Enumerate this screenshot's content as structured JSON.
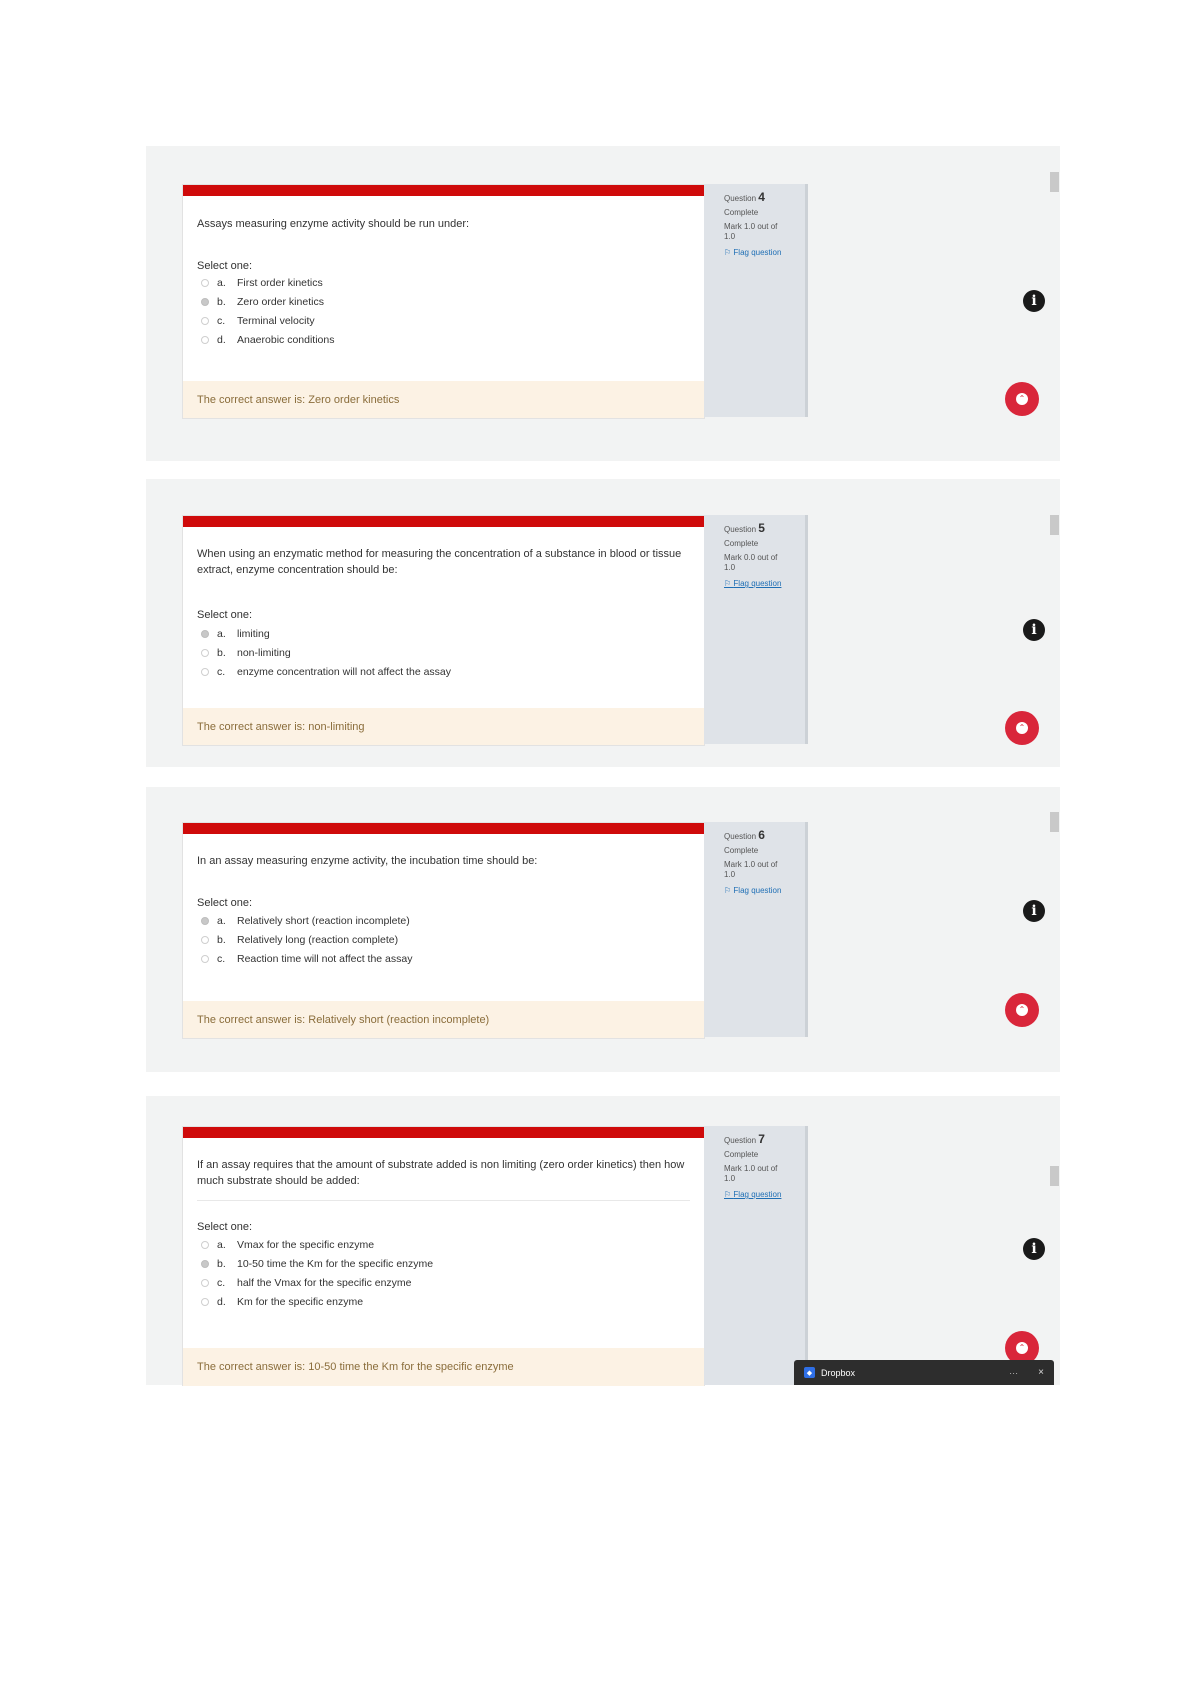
{
  "questions": [
    {
      "number": "4",
      "label": "Question",
      "state": "Complete",
      "mark": "Mark 1.0 out of",
      "mark_total": "1.0",
      "flag": "Flag question",
      "text": "Assays measuring enzyme activity should be run under:",
      "select_label": "Select one:",
      "options": [
        {
          "letter": "a.",
          "text": "First order kinetics",
          "checked": false
        },
        {
          "letter": "b.",
          "text": "Zero order kinetics",
          "checked": true
        },
        {
          "letter": "c.",
          "text": "Terminal velocity",
          "checked": false
        },
        {
          "letter": "d.",
          "text": "Anaerobic conditions",
          "checked": false
        }
      ],
      "feedback": "The correct answer is: Zero order kinetics"
    },
    {
      "number": "5",
      "label": "Question",
      "state": "Complete",
      "mark": "Mark 0.0 out of",
      "mark_total": "1.0",
      "flag": "Flag question",
      "text": "When using an enzymatic method for measuring the concentration of a substance in blood or tissue extract, enzyme concentration should be:",
      "select_label": "Select one:",
      "options": [
        {
          "letter": "a.",
          "text": "limiting",
          "checked": true
        },
        {
          "letter": "b.",
          "text": "non-limiting",
          "checked": false
        },
        {
          "letter": "c.",
          "text": "enzyme concentration will not affect the assay",
          "checked": false
        }
      ],
      "feedback": "The correct answer is: non-limiting"
    },
    {
      "number": "6",
      "label": "Question",
      "state": "Complete",
      "mark": "Mark 1.0 out of",
      "mark_total": "1.0",
      "flag": "Flag question",
      "text": "In an assay measuring enzyme activity, the incubation time should be:",
      "select_label": "Select one:",
      "options": [
        {
          "letter": "a.",
          "text": "Relatively short (reaction incomplete)",
          "checked": true
        },
        {
          "letter": "b.",
          "text": "Relatively long (reaction complete)",
          "checked": false
        },
        {
          "letter": "c.",
          "text": "Reaction time will not affect the assay",
          "checked": false
        }
      ],
      "feedback": "The correct answer is: Relatively short (reaction incomplete)"
    },
    {
      "number": "7",
      "label": "Question",
      "state": "Complete",
      "mark": "Mark 1.0 out of",
      "mark_total": "1.0",
      "flag": "Flag question",
      "text": "If an assay requires that the amount of substrate added is non limiting (zero order kinetics) then how much substrate should be added:",
      "select_label": "Select one:",
      "options": [
        {
          "letter": "a.",
          "text": "Vmax for the specific enzyme",
          "checked": false
        },
        {
          "letter": "b.",
          "text": "10-50 time the Km for the specific enzyme",
          "checked": true
        },
        {
          "letter": "c.",
          "text": "half the Vmax for the specific enzyme",
          "checked": false
        },
        {
          "letter": "d.",
          "text": "Km for the specific enzyme",
          "checked": false
        }
      ],
      "feedback": "The correct answer is: 10-50 time the Km for the specific enzyme"
    }
  ],
  "info_icon": "i",
  "dropbox": {
    "label": "Dropbox",
    "dots": "···",
    "close": "×"
  },
  "colors": {
    "accent_bar": "#cf0a0a",
    "feedback_bg": "#fcf2e4",
    "scroll_button": "#d9263a"
  }
}
